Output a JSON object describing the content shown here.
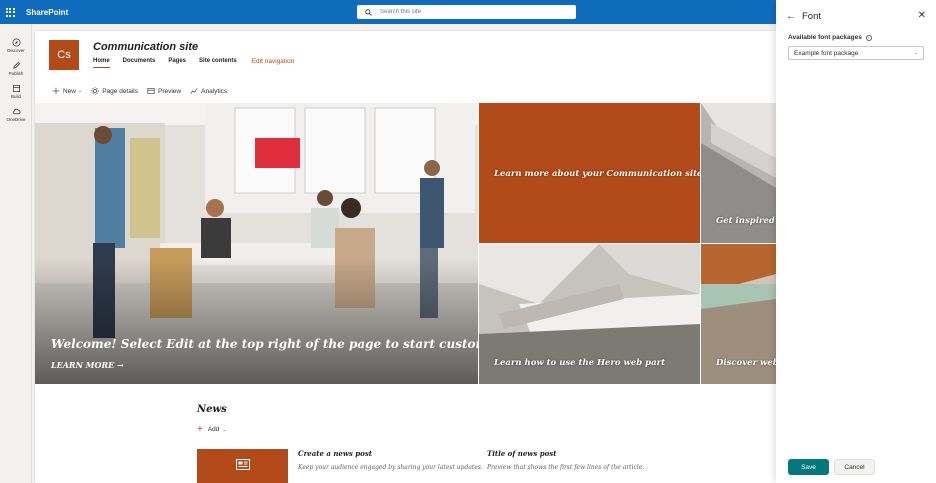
{
  "suite": {
    "app_name": "SharePoint",
    "search_placeholder": "Search this site"
  },
  "app_rail": [
    {
      "label": "Discover",
      "icon": "compass-icon"
    },
    {
      "label": "Publish",
      "icon": "pencil-icon"
    },
    {
      "label": "Build",
      "icon": "build-icon"
    },
    {
      "label": "OneDrive",
      "icon": "cloud-icon"
    }
  ],
  "site": {
    "logo_text": "Cs",
    "title": "Communication site",
    "nav": [
      "Home",
      "Documents",
      "Pages",
      "Site contents"
    ],
    "edit_nav": "Edit navigation",
    "accent": "#b24a1a"
  },
  "command_bar": {
    "new": "New",
    "page_details": "Page details",
    "preview": "Preview",
    "analytics": "Analytics"
  },
  "hero": {
    "main_title": "Welcome! Select Edit at the top right of the page to start customizing",
    "main_link": "LEARN MORE",
    "tiles": [
      {
        "caption": "Learn more about your Communication site"
      },
      {
        "caption": "Get inspired wi"
      },
      {
        "caption": "Learn how to use the Hero web part"
      },
      {
        "caption": "Discover web pa"
      }
    ]
  },
  "news": {
    "title": "News",
    "add": "Add",
    "posts": [
      {
        "title": "Create a news post",
        "desc": "Keep your audience engaged by sharing your latest updates."
      },
      {
        "title": "Title of news post",
        "desc": "Preview that shows the first few lines of the article."
      }
    ]
  },
  "panel": {
    "title": "Font",
    "packages_label": "Available font packages",
    "selected_package": "Example font package",
    "save": "Save",
    "cancel": "Cancel",
    "save_color": "#03787c"
  }
}
